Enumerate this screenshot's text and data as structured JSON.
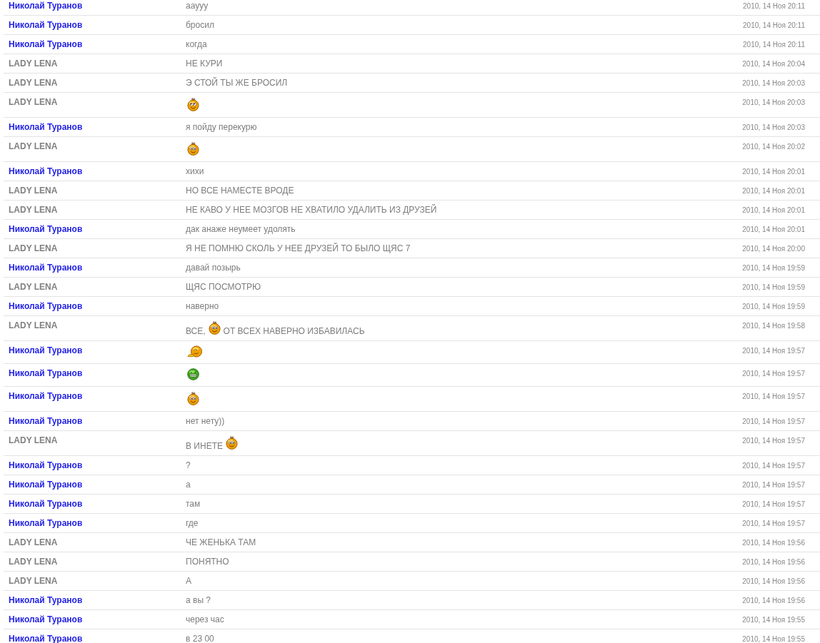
{
  "messages": [
    {
      "author": "Николай Туранов",
      "color": "#1f1fe6",
      "parts": [
        {
          "kind": "text",
          "text": "ааууу"
        }
      ],
      "time": "2010, 14 Ноя 20:11"
    },
    {
      "author": "Николай Туранов",
      "color": "#1f1fe6",
      "parts": [
        {
          "kind": "text",
          "text": "бросил"
        }
      ],
      "time": "2010, 14 Ноя 20:11"
    },
    {
      "author": "Николай Туранов",
      "color": "#1f1fe6",
      "parts": [
        {
          "kind": "text",
          "text": "когда"
        }
      ],
      "time": "2010, 14 Ноя 20:11"
    },
    {
      "author": "LADY LENA",
      "color": "#808080",
      "parts": [
        {
          "kind": "text",
          "text": "НЕ КУРИ"
        }
      ],
      "time": "2010, 14 Ноя 20:04"
    },
    {
      "author": "LADY LENA",
      "color": "#808080",
      "parts": [
        {
          "kind": "text",
          "text": "Э СТОЙ ТЫ ЖЕ БРОСИЛ"
        }
      ],
      "time": "2010, 14 Ноя 20:03"
    },
    {
      "author": "LADY LENA",
      "color": "#808080",
      "parts": [
        {
          "kind": "sidelong"
        }
      ],
      "time": "2010, 14 Ноя 20:03"
    },
    {
      "author": "Николай Туранов",
      "color": "#1f1fe6",
      "parts": [
        {
          "kind": "text",
          "text": "я пойду перекурю"
        }
      ],
      "time": "2010, 14 Ноя 20:03"
    },
    {
      "author": "LADY LENA",
      "color": "#808080",
      "parts": [
        {
          "kind": "smiley"
        }
      ],
      "time": "2010, 14 Ноя 20:02"
    },
    {
      "author": "Николай Туранов",
      "color": "#1f1fe6",
      "parts": [
        {
          "kind": "text",
          "text": "хихи"
        }
      ],
      "time": "2010, 14 Ноя 20:01"
    },
    {
      "author": "LADY LENA",
      "color": "#808080",
      "parts": [
        {
          "kind": "text",
          "text": "НО ВСЕ НАМЕСТЕ ВРОДЕ"
        }
      ],
      "time": "2010, 14 Ноя 20:01"
    },
    {
      "author": "LADY LENA",
      "color": "#808080",
      "parts": [
        {
          "kind": "text",
          "text": "НЕ КАВО У НЕЕ МОЗГОВ НЕ ХВАТИЛО УДАЛИТЬ ИЗ ДРУЗЕЙ"
        }
      ],
      "time": "2010, 14 Ноя 20:01"
    },
    {
      "author": "Николай Туранов",
      "color": "#1f1fe6",
      "parts": [
        {
          "kind": "text",
          "text": "дак анаже неумеет удолять"
        }
      ],
      "time": "2010, 14 Ноя 20:01"
    },
    {
      "author": "LADY LENA",
      "color": "#808080",
      "parts": [
        {
          "kind": "text",
          "text": "Я НЕ ПОМНЮ СКОЛЬ У НЕЕ ДРУЗЕЙ ТО БЫЛО ЩЯС 7"
        }
      ],
      "time": "2010, 14 Ноя 20:00"
    },
    {
      "author": "Николай Туранов",
      "color": "#1f1fe6",
      "parts": [
        {
          "kind": "text",
          "text": "давай позырь"
        }
      ],
      "time": "2010, 14 Ноя 19:59"
    },
    {
      "author": "LADY LENA",
      "color": "#808080",
      "parts": [
        {
          "kind": "text",
          "text": "ЩЯС ПОСМОТРЮ"
        }
      ],
      "time": "2010, 14 Ноя 19:59"
    },
    {
      "author": "Николай Туранов",
      "color": "#1f1fe6",
      "parts": [
        {
          "kind": "text",
          "text": "наверно"
        }
      ],
      "time": "2010, 14 Ноя 19:59"
    },
    {
      "author": "LADY LENA",
      "color": "#808080",
      "parts": [
        {
          "kind": "text",
          "text": "ВСЕ,"
        },
        {
          "kind": "smiley"
        },
        {
          "kind": "text",
          "text": "ОТ ВСЕХ НАВЕРНО ИЗБАВИЛАСЬ"
        }
      ],
      "time": "2010, 14 Ноя 19:58"
    },
    {
      "author": "Николай Туранов",
      "color": "#1f1fe6",
      "parts": [
        {
          "kind": "hand"
        }
      ],
      "time": "2010, 14 Ноя 19:57"
    },
    {
      "author": "Николай Туранов",
      "color": "#1f1fe6",
      "parts": [
        {
          "kind": "grin"
        }
      ],
      "time": "2010, 14 Ноя 19:57"
    },
    {
      "author": "Николай Туранов",
      "color": "#1f1fe6",
      "parts": [
        {
          "kind": "smiley"
        }
      ],
      "time": "2010, 14 Ноя 19:57"
    },
    {
      "author": "Николай Туранов",
      "color": "#1f1fe6",
      "parts": [
        {
          "kind": "text",
          "text": "нет нету))"
        }
      ],
      "time": "2010, 14 Ноя 19:57"
    },
    {
      "author": "LADY LENA",
      "color": "#808080",
      "parts": [
        {
          "kind": "text",
          "text": "В ИНЕТЕ"
        },
        {
          "kind": "smiley"
        }
      ],
      "time": "2010, 14 Ноя 19:57"
    },
    {
      "author": "Николай Туранов",
      "color": "#1f1fe6",
      "parts": [
        {
          "kind": "text",
          "text": "?"
        }
      ],
      "time": "2010, 14 Ноя 19:57"
    },
    {
      "author": "Николай Туранов",
      "color": "#1f1fe6",
      "parts": [
        {
          "kind": "text",
          "text": "а"
        }
      ],
      "time": "2010, 14 Ноя 19:57"
    },
    {
      "author": "Николай Туранов",
      "color": "#1f1fe6",
      "parts": [
        {
          "kind": "text",
          "text": "там"
        }
      ],
      "time": "2010, 14 Ноя 19:57"
    },
    {
      "author": "Николай Туранов",
      "color": "#1f1fe6",
      "parts": [
        {
          "kind": "text",
          "text": "где"
        }
      ],
      "time": "2010, 14 Ноя 19:57"
    },
    {
      "author": "LADY LENA",
      "color": "#808080",
      "parts": [
        {
          "kind": "text",
          "text": "ЧЕ ЖЕНЬКА ТАМ"
        }
      ],
      "time": "2010, 14 Ноя 19:56"
    },
    {
      "author": "LADY LENA",
      "color": "#808080",
      "parts": [
        {
          "kind": "text",
          "text": "ПОНЯТНО"
        }
      ],
      "time": "2010, 14 Ноя 19:56"
    },
    {
      "author": "LADY LENA",
      "color": "#808080",
      "parts": [
        {
          "kind": "text",
          "text": "А"
        }
      ],
      "time": "2010, 14 Ноя 19:56"
    },
    {
      "author": "Николай Туранов",
      "color": "#1f1fe6",
      "parts": [
        {
          "kind": "text",
          "text": "а вы ?"
        }
      ],
      "time": "2010, 14 Ноя 19:56"
    },
    {
      "author": "Николай Туранов",
      "color": "#1f1fe6",
      "parts": [
        {
          "kind": "text",
          "text": "через час"
        }
      ],
      "time": "2010, 14 Ноя 19:55"
    },
    {
      "author": "Николай Туранов",
      "color": "#1f1fe6",
      "parts": [
        {
          "kind": "text",
          "text": "в 23 00"
        }
      ],
      "time": "2010, 14 Ноя 19:55"
    }
  ]
}
